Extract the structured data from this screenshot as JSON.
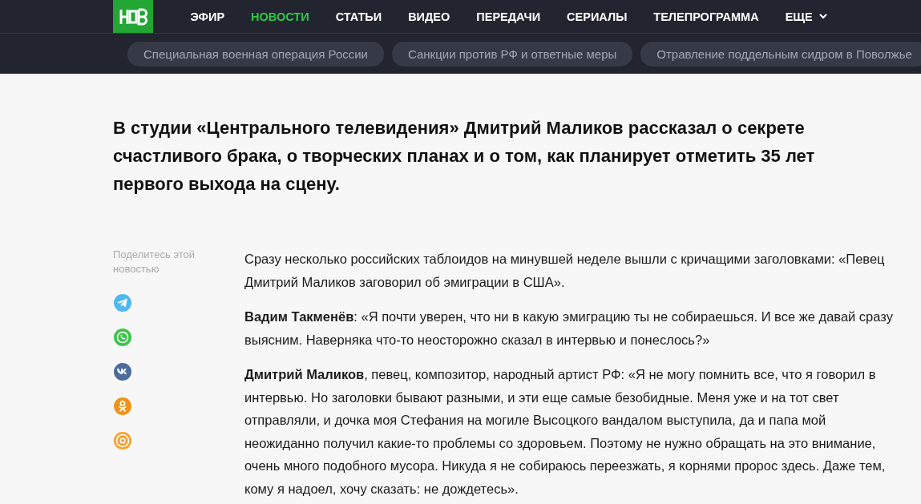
{
  "nav": {
    "items": [
      {
        "label": "ЭФИР",
        "selected": false
      },
      {
        "label": "НОВОСТИ",
        "selected": true
      },
      {
        "label": "СТАТЬИ",
        "selected": false
      },
      {
        "label": "ВИДЕО",
        "selected": false
      },
      {
        "label": "ПЕРЕДАЧИ",
        "selected": false
      },
      {
        "label": "СЕРИАЛЫ",
        "selected": false
      },
      {
        "label": "ТЕЛЕПРОГРАММА",
        "selected": false
      },
      {
        "label": "ЕЩЕ",
        "selected": false,
        "kind": "dropdown"
      }
    ]
  },
  "topics": [
    "Специальная военная операция России",
    "Санкции против РФ и ответные меры",
    "Отравление поддельным сидром в Поволжье"
  ],
  "headline": "В студии «Центрального телевидения» Дмитрий Маликов рассказал о секрете счастливого брака, о творческих планах и о том, как планирует отметить 35 лет первого выхода на сцену.",
  "share": {
    "label": "Поделитесь этой новостью",
    "networks": [
      {
        "kind": "telegram",
        "color": "#4fb8ef"
      },
      {
        "kind": "whatsapp",
        "color": "#3cc54c"
      },
      {
        "kind": "vk",
        "color": "#4c6c9c"
      },
      {
        "kind": "ok",
        "color": "#f0931c"
      },
      {
        "kind": "mail",
        "color": "#f9a02c"
      }
    ]
  },
  "paragraphs": [
    "Сразу несколько российских таблоидов на минувшей неделе вышли с кричащими заголовками: «Певец Дмитрий Маликов заговорил об эмиграции в США».",
    "**Вадим Такменёв**: «Я почти уверен, что ни в какую эмиграцию ты не собираешься. И все же давай сразу выясним. Наверняка что-то неосторожно сказал в интервью и понеслось?»",
    "**Дмитрий Маликов**, певец, композитор, народный артист РФ: «Я не могу помнить все, что я говорил в интервью. Но заголовки бывают разными, и эти еще самые безобидные. Меня уже и на тот свет отправляли, и дочка моя Стефания на могиле Высоцкого вандалом выступила, да и папа мой неожиданно получил какие-то проблемы со здоровьем. Поэтому не нужно обращать на это внимание, очень много подобного мусора. Никуда я не собираюсь переезжать, я корнями пророс здесь. Даже тем, кому я надоел, хочу сказать: не дождетесь»."
  ]
}
